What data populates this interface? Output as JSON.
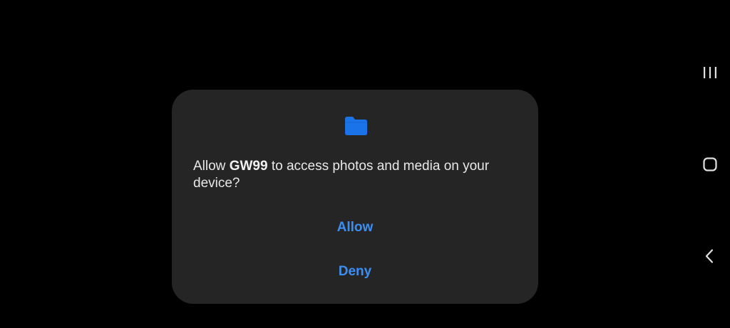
{
  "dialog": {
    "icon": "folder-icon",
    "message_prefix": "Allow ",
    "app_name": "GW99",
    "message_suffix": " to access photos and media on your device?",
    "allow_label": "Allow",
    "deny_label": "Deny"
  },
  "navigation_bar": {
    "recents_icon": "recents-icon",
    "home_icon": "home-icon",
    "back_icon": "back-icon"
  },
  "colors": {
    "background": "#000000",
    "dialog_background": "#252525",
    "accent": "#3d8ef2",
    "text": "#e8e8e8"
  }
}
